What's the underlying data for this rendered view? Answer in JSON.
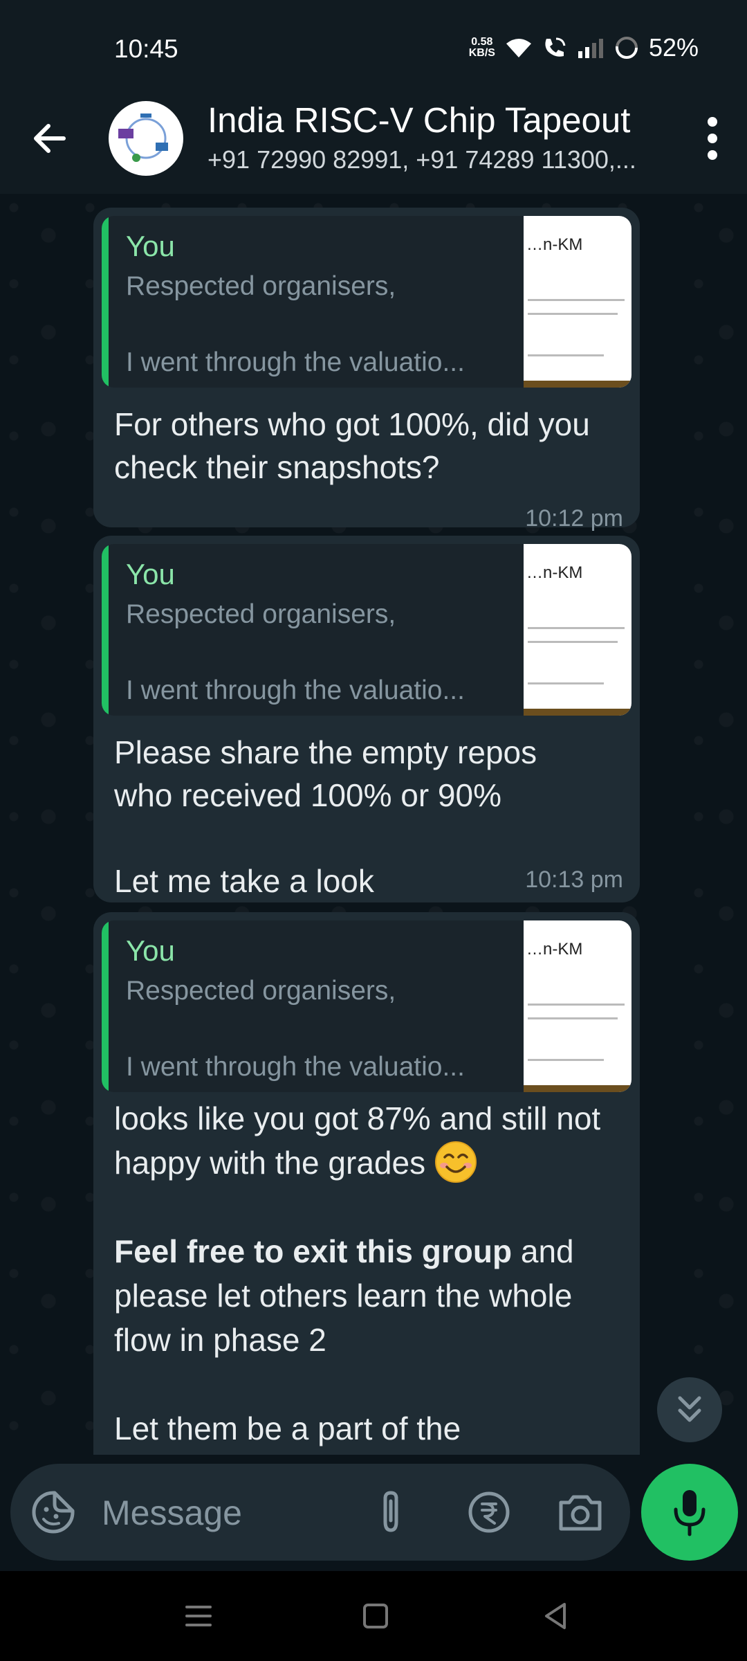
{
  "status_bar": {
    "time": "10:45",
    "net_speed_value": "0.58",
    "net_speed_unit": "KB/S",
    "battery": "52%"
  },
  "header": {
    "title": "India RISC-V Chip Tapeout",
    "subtitle": "+91 72990 82991, +91 74289 11300,..."
  },
  "messages": [
    {
      "quote_author": "You",
      "quote_line1": "Respected organisers,",
      "quote_line2": "I went through the valuatio...",
      "text": "For others who got 100%, did you check their snapshots?",
      "time": "10:12 pm"
    },
    {
      "quote_author": "You",
      "quote_line1": "Respected organisers,",
      "quote_line2": "I went through the valuatio...",
      "text_p1": "Please share the empty repos who received 100% or 90%",
      "text_p2": "Let me take a look",
      "time": "10:13 pm"
    },
    {
      "quote_author": "You",
      "quote_line1": "Respected organisers,",
      "quote_line2": "I went through the valuatio...",
      "text_p1": "looks like you got 87% and still not happy with the grades",
      "text_p2_bold": "Feel free to exit this group",
      "text_p2_rest": " and please let others learn the whole flow in phase 2",
      "text_p3": "Let them be a part of the"
    }
  ],
  "thumbnail_text": "…n-KM",
  "composer": {
    "placeholder": "Message"
  },
  "colors": {
    "accent_green": "#21c063",
    "bubble_bg": "#1f2c34",
    "header_bg": "#111b21"
  }
}
